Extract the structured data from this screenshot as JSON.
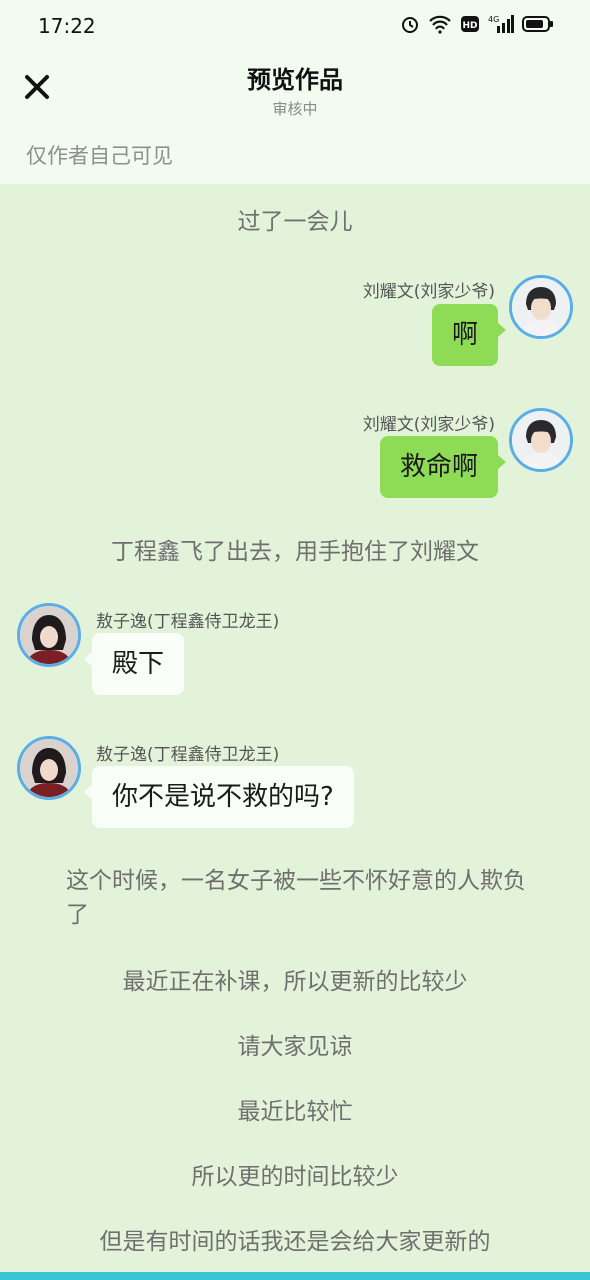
{
  "status_bar": {
    "time": "17:22",
    "icons": [
      "alarm-icon",
      "wifi-icon",
      "hd-icon",
      "4g-signal-icon",
      "battery-icon"
    ]
  },
  "header": {
    "title": "预览作品",
    "subtitle": "审核中",
    "visibility_note": "仅作者自己可见"
  },
  "story": {
    "narration_1": "过了一会儿",
    "msg_1": {
      "speaker": "刘耀文(刘家少爷)",
      "text": "啊",
      "side": "right"
    },
    "msg_2": {
      "speaker": "刘耀文(刘家少爷)",
      "text": "救命啊",
      "side": "right"
    },
    "narration_2": "丁程鑫飞了出去，用手抱住了刘耀文",
    "msg_3": {
      "speaker": "敖子逸(丁程鑫侍卫龙王)",
      "text": "殿下",
      "side": "left"
    },
    "msg_4": {
      "speaker": "敖子逸(丁程鑫侍卫龙王)",
      "text": "你不是说不救的吗?",
      "side": "left"
    },
    "narration_3": "这个时候，一名女子被一些不怀好意的人欺负了",
    "narration_4": "最近正在补课，所以更新的比较少",
    "narration_5": "请大家见谅",
    "narration_6": "最近比较忙",
    "narration_7": "所以更的时间比较少",
    "narration_8": "但是有时间的话我还是会给大家更新的"
  },
  "colors": {
    "page_background": "#e3f3da",
    "header_background": "#f1fbf0",
    "right_bubble": "#8edc56",
    "left_bubble": "#f8fdf7",
    "avatar_ring": "#5aaee8"
  }
}
